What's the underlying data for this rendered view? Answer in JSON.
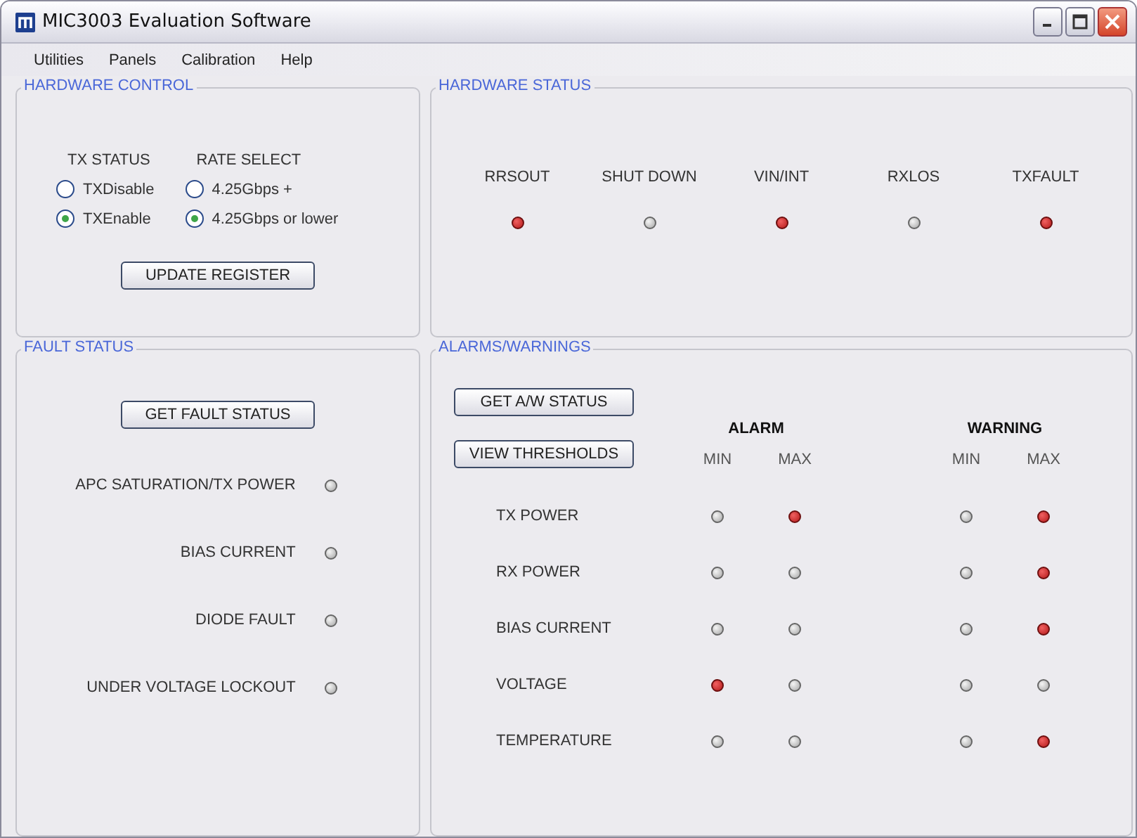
{
  "window": {
    "title": "MIC3003 Evaluation Software"
  },
  "menu": [
    "Utilities",
    "Panels",
    "Calibration",
    "Help"
  ],
  "hardware_control": {
    "title": "HARDWARE CONTROL",
    "button": "UPDATE REGISTER",
    "groups": [
      {
        "label": "TX STATUS",
        "options": [
          {
            "label": "TXDisable",
            "selected": false
          },
          {
            "label": "TXEnable",
            "selected": true
          }
        ]
      },
      {
        "label": "RATE SELECT",
        "options": [
          {
            "label": "4.25Gbps +",
            "selected": false
          },
          {
            "label": "4.25Gbps or lower",
            "selected": true
          }
        ]
      }
    ]
  },
  "hardware_status": {
    "title": "HARDWARE STATUS",
    "indicators": [
      {
        "label": "RRSOUT",
        "lit": true
      },
      {
        "label": "SHUT DOWN",
        "lit": false
      },
      {
        "label": "VIN/INT",
        "lit": true
      },
      {
        "label": "RXLOS",
        "lit": false
      },
      {
        "label": "TXFAULT",
        "lit": true
      }
    ]
  },
  "fault_status": {
    "title": "FAULT STATUS",
    "button": "GET FAULT STATUS",
    "rows": [
      {
        "label": "APC SATURATION/TX POWER",
        "lit": false
      },
      {
        "label": "BIAS CURRENT",
        "lit": false
      },
      {
        "label": "DIODE FAULT",
        "lit": false
      },
      {
        "label": "UNDER VOLTAGE LOCKOUT",
        "lit": false
      }
    ]
  },
  "alarms": {
    "title": "ALARMS/WARNINGS",
    "buttons": [
      "GET A/W STATUS",
      "VIEW THRESHOLDS"
    ],
    "groups": [
      {
        "label": "ALARM",
        "columns": [
          "MIN",
          "MAX"
        ]
      },
      {
        "label": "WARNING",
        "columns": [
          "MIN",
          "MAX"
        ]
      }
    ],
    "rows": [
      {
        "label": "TX POWER",
        "lit": [
          false,
          true,
          false,
          true
        ]
      },
      {
        "label": "RX POWER",
        "lit": [
          false,
          false,
          false,
          true
        ]
      },
      {
        "label": "BIAS CURRENT",
        "lit": [
          false,
          false,
          false,
          true
        ]
      },
      {
        "label": "VOLTAGE",
        "lit": [
          true,
          false,
          false,
          false
        ]
      },
      {
        "label": "TEMPERATURE",
        "lit": [
          false,
          false,
          false,
          true
        ]
      }
    ]
  }
}
